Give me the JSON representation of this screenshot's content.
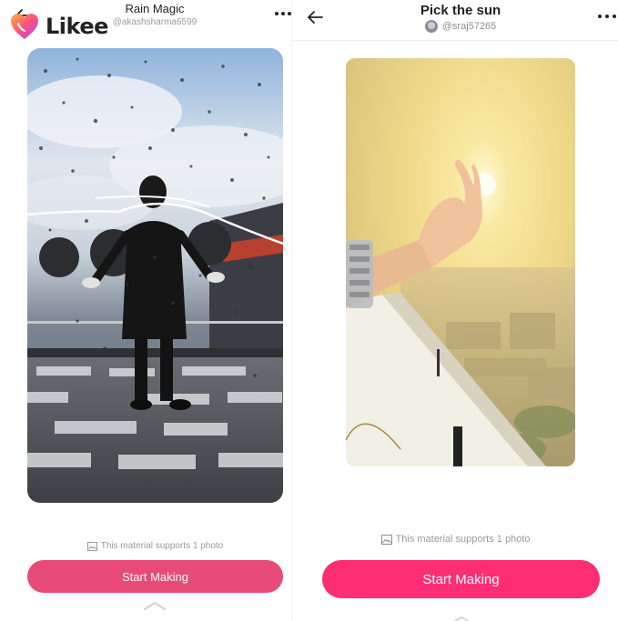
{
  "left": {
    "logo_text": "Likee",
    "title": "Rain Magic",
    "username": "@akashsharma6599",
    "support_note": "This material supports 1 photo",
    "start_button": "Start Making"
  },
  "right": {
    "title": "Pick the sun",
    "username": "@sraj57265",
    "support_note": "This material supports 1 photo",
    "start_button": "Start Making"
  },
  "colors": {
    "accent_left": "#e94b78",
    "accent_right": "#ff2e74"
  },
  "icons": [
    "back-arrow-icon",
    "likee-logo-heart-icon",
    "more-dots-icon",
    "photo-icon",
    "chevron-up-icon"
  ]
}
